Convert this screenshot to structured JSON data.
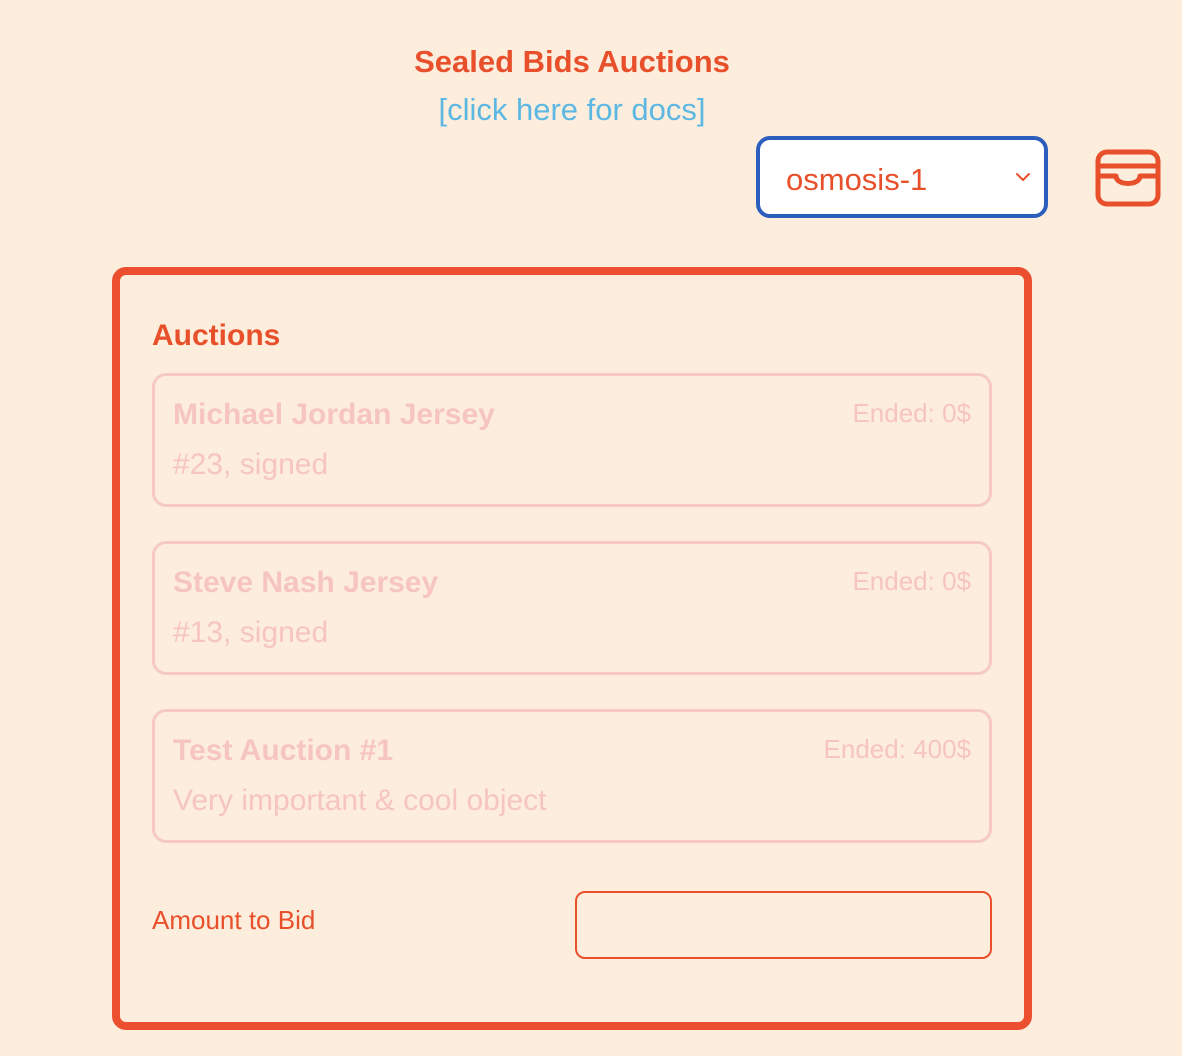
{
  "header": {
    "title": "Sealed Bids Auctions",
    "docs_link": "[click here for docs]"
  },
  "chain_select": {
    "selected": "osmosis-1"
  },
  "wallet": {
    "icon": "wallet-icon"
  },
  "auctions": {
    "heading": "Auctions",
    "items": [
      {
        "name": "Michael Jordan Jersey",
        "description": "#23, signed",
        "status": "Ended: 0$"
      },
      {
        "name": "Steve Nash Jersey",
        "description": "#13, signed",
        "status": "Ended: 0$"
      },
      {
        "name": "Test Auction #1",
        "description": "Very important & cool object",
        "status": "Ended: 400$"
      }
    ]
  },
  "bid": {
    "label": "Amount to Bid",
    "value": ""
  },
  "colors": {
    "background": "#fdeddd",
    "accent": "#e8502b",
    "link": "#5cb8e2",
    "select_border": "#2c5fbd",
    "disabled_text": "#f6c5c0"
  }
}
